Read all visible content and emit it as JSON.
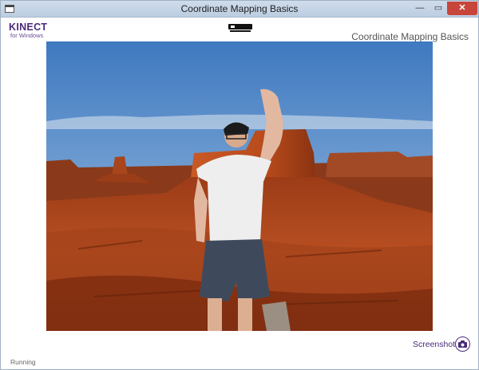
{
  "window": {
    "title": "Coordinate Mapping Basics",
    "controls": {
      "minimize": "—",
      "maximize": "▭",
      "close": "✕"
    }
  },
  "brand": {
    "name": "KINECT",
    "subtitle": "for Windows"
  },
  "header": {
    "title": "Coordinate Mapping Basics"
  },
  "screenshot": {
    "label": "Screenshot",
    "icon": "camera-icon"
  },
  "status": {
    "text": "Running"
  },
  "colors": {
    "accent": "#4b2a7a",
    "close": "#c7453a",
    "sky": "#5d92c9",
    "rock": "#b54a1f"
  }
}
